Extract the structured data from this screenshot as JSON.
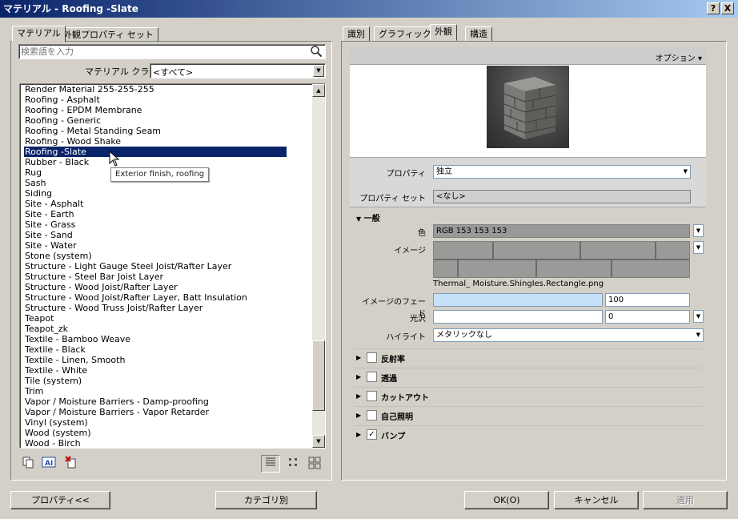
{
  "window": {
    "title": "マテリアル - Roofing -Slate",
    "help": "?",
    "close": "X"
  },
  "left_tabs": [
    "マテリアル",
    "外観プロパティ セット"
  ],
  "search": {
    "placeholder": "検索語を入力"
  },
  "material_class": {
    "label": "マテリアル クラス:",
    "value": "<すべて>"
  },
  "materials": [
    "Render Material 255-255-255",
    "Roofing - Asphalt",
    "Roofing - EPDM Membrane",
    "Roofing - Generic",
    "Roofing - Metal Standing Seam",
    "Roofing - Wood Shake",
    "Roofing -Slate",
    "Rubber - Black",
    "Rug",
    "Sash",
    "Siding",
    "Site - Asphalt",
    "Site - Earth",
    "Site - Grass",
    "Site - Sand",
    "Site - Water",
    "Stone (system)",
    "Structure - Light Gauge Steel Joist/Rafter Layer",
    "Structure - Steel Bar Joist Layer",
    "Structure - Wood Joist/Rafter Layer",
    "Structure - Wood Joist/Rafter Layer, Batt Insulation",
    "Structure - Wood Truss Joist/Rafter Layer",
    "Teapot",
    "Teapot_zk",
    "Textile - Bamboo Weave",
    "Textile - Black",
    "Textile - Linen, Smooth",
    "Textile - White",
    "Tile (system)",
    "Trim",
    "Vapor / Moisture Barriers - Damp-proofing",
    "Vapor / Moisture Barriers - Vapor Retarder",
    "Vinyl (system)",
    "Wood (system)",
    "Wood - Birch"
  ],
  "selected_material": "Roofing -Slate",
  "tooltip": "Exterior finish, roofing",
  "right_tabs": [
    "識別",
    "グラフィックス",
    "外観",
    "構造"
  ],
  "active_right_tab": "外観",
  "options_label": "オプション ▾",
  "property": {
    "label": "プロパティ",
    "value": "独立"
  },
  "property_set": {
    "label": "プロパティ セット",
    "value": "<なし>"
  },
  "general": {
    "title": "一般",
    "color_label": "色",
    "color_value": "RGB 153 153 153",
    "image_label": "イメージ",
    "image_file": "Thermal_ Moisture.Shingles.Rectangle.png",
    "fade_label": "イメージのフェード",
    "fade_value": "100",
    "gloss_label": "光沢",
    "gloss_value": "0",
    "highlight_label": "ハイライト",
    "highlight_value": "メタリックなし"
  },
  "sections": [
    {
      "label": "反射率",
      "checked": false
    },
    {
      "label": "透過",
      "checked": false
    },
    {
      "label": "カットアウト",
      "checked": false
    },
    {
      "label": "自己照明",
      "checked": false
    },
    {
      "label": "バンプ",
      "checked": true
    }
  ],
  "buttons": {
    "properties": "プロパティ<<",
    "category": "カテゴリ別",
    "ok": "OK(O)",
    "cancel": "キャンセル",
    "apply": "適用"
  }
}
